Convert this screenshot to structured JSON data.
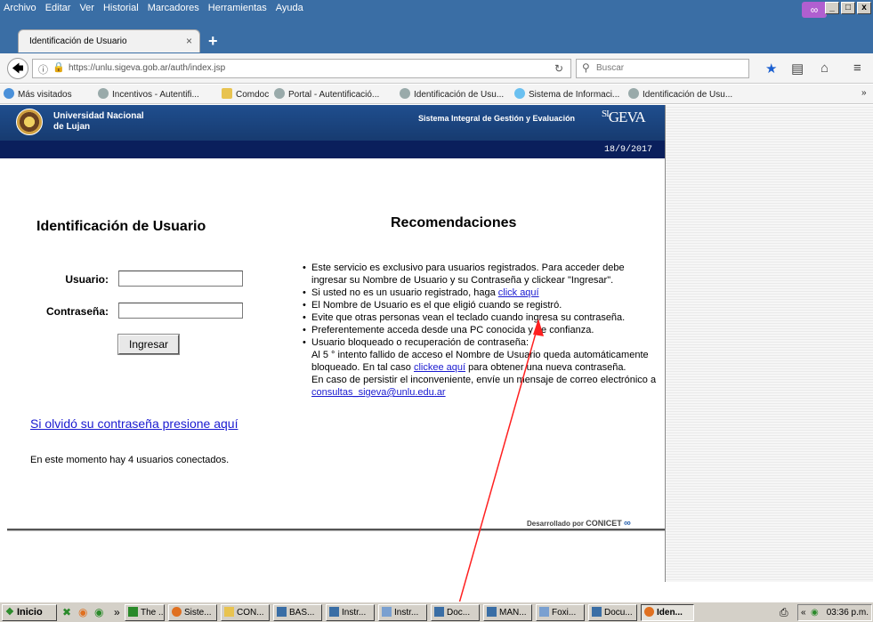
{
  "menu": {
    "items": [
      "Archivo",
      "Editar",
      "Ver",
      "Historial",
      "Marcadores",
      "Herramientas",
      "Ayuda"
    ]
  },
  "window": {
    "mask_icon": "mask-icon",
    "controls": [
      "_",
      "□",
      "x"
    ]
  },
  "tab": {
    "title": "Identificación de Usuario",
    "close": "×",
    "new_tab": "+"
  },
  "nav": {
    "url": "https://unlu.sigeva.gob.ar/auth/index.jsp",
    "search_placeholder": "Buscar"
  },
  "bookmarks": [
    "Más visitados",
    "Incentivos - Autentifi...",
    "Comdoc",
    "Portal - Autentificació...",
    "Identificación de Usu...",
    "Sistema de Informaci...",
    "Identificación de Usu..."
  ],
  "bookmarks_overflow": "»",
  "site": {
    "university": "Universidad Nacional",
    "university_line2": "de Lujan",
    "system_name": "Sistema Integral de Gestión y Evaluación",
    "logo_si": "SI",
    "logo_geva": "GEVA",
    "date": "18/9/2017"
  },
  "login": {
    "title": "Identificación de Usuario",
    "user_label": "Usuario:",
    "user_value": "",
    "password_label": "Contraseña:",
    "password_value": "",
    "submit": "Ingresar",
    "forgot_link": "Si olvidó su contraseña presione aquí",
    "online_text": "En este momento hay 4 usuarios conectados."
  },
  "recommendations": {
    "title": "Recomendaciones",
    "r1": "Este servicio es exclusivo para usuarios registrados. Para acceder debe ingresar su Nombre de Usuario y su Contraseña y clickear \"Ingresar\".",
    "r2_text": "Si usted no es un usuario registrado, haga ",
    "r2_link": "click aquí",
    "r3": "El Nombre de Usuario es el que eligió cuando se registró.",
    "r4": "Evite que otras personas vean el teclado cuando ingresa su contraseña.",
    "r5": "Preferentemente acceda desde una PC conocida y de confianza.",
    "r6_a": "Usuario bloqueado o recuperación de contraseña:",
    "r6_b": "Al 5 ° intento fallido de acceso el Nombre de Usuario queda automáticamente bloqueado. En tal caso ",
    "r6_link": "clickee aquí",
    "r6_c": " para obtener una nueva contraseña.",
    "r6_d": "En caso de persistir el inconveniente, envíe un mensaje de correo electrónico a ",
    "r6_email": "consultas_sigeva@unlu.edu.ar"
  },
  "footer": {
    "credit": "Desarrollado por",
    "org": "CONICET"
  },
  "taskbar": {
    "start": "Inicio",
    "chevron": "»",
    "buttons": [
      "The ...",
      "Siste...",
      "CON...",
      "BAS...",
      "Instr...",
      "Instr...",
      "Doc...",
      "MAN...",
      "Foxi...",
      "Docu...",
      "Iden..."
    ],
    "tray_chevron": "«",
    "clock": "03:36 p.m."
  }
}
